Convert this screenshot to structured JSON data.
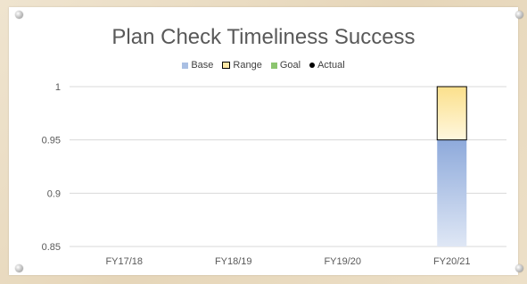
{
  "chart_data": {
    "type": "bar",
    "title": "Plan Check Timeliness Success",
    "categories": [
      "FY17/18",
      "FY18/19",
      "FY19/20",
      "FY20/21"
    ],
    "ylim": [
      0.85,
      1
    ],
    "yticks": [
      "0.85",
      "0.9",
      "0.95",
      "1"
    ],
    "grid": true,
    "legend_position": "top",
    "legend": [
      "Base",
      "Range",
      "Goal",
      "Actual"
    ],
    "series": [
      {
        "name": "Base",
        "values": [
          null,
          null,
          null,
          0.95
        ]
      },
      {
        "name": "Range",
        "values": [
          null,
          null,
          null,
          0.05
        ]
      },
      {
        "name": "Goal",
        "values": [
          null,
          null,
          null,
          null
        ]
      },
      {
        "name": "Actual",
        "values": [
          null,
          null,
          null,
          null
        ]
      }
    ],
    "colors": {
      "base": "#8eaadb",
      "range": "#fde8a6",
      "goal": "#8cc56f",
      "actual": "#000000",
      "grid": "#d9d9d9",
      "text": "#595959"
    }
  }
}
